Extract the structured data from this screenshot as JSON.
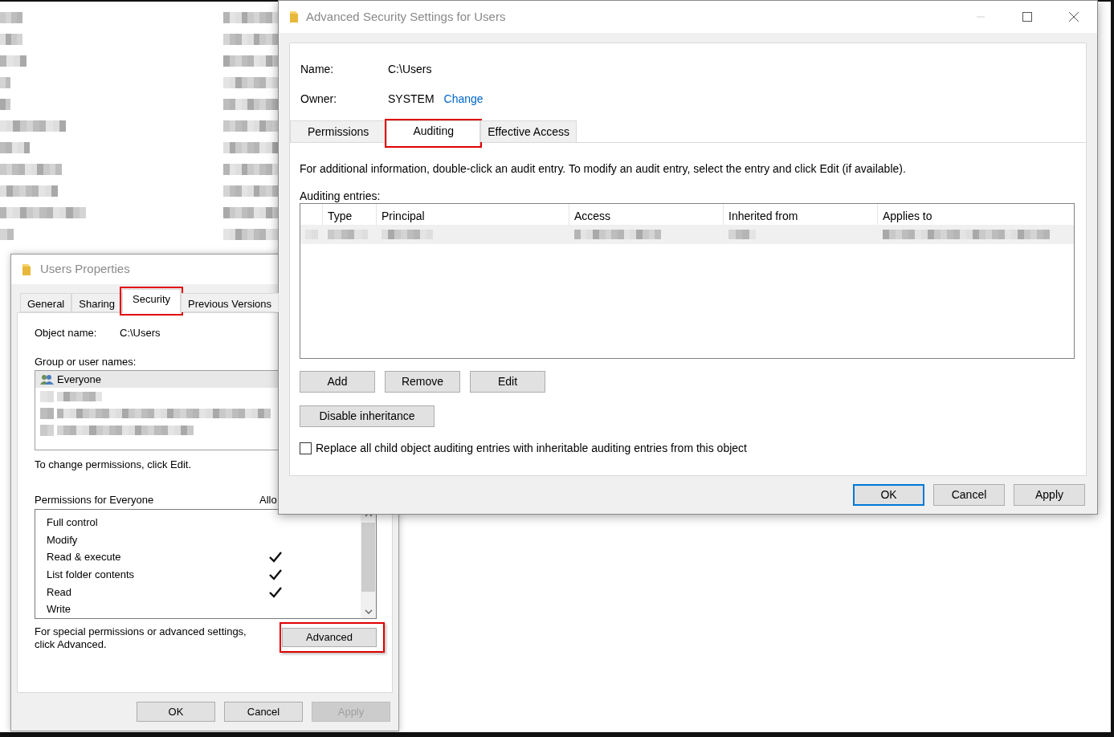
{
  "users_properties": {
    "title": "Users Properties",
    "tabs": [
      {
        "label": "General",
        "selected": false,
        "highlighted": false
      },
      {
        "label": "Sharing",
        "selected": false,
        "highlighted": false
      },
      {
        "label": "Security",
        "selected": true,
        "highlighted": true
      },
      {
        "label": "Previous Versions",
        "selected": false,
        "highlighted": false
      }
    ],
    "object_name_label": "Object name:",
    "object_name": "C:\\Users",
    "group_label": "Group or user names:",
    "users": [
      {
        "kind": "user",
        "name": "Everyone",
        "selected": true
      },
      {
        "kind": "redacted",
        "selected": false
      },
      {
        "kind": "redacted",
        "selected": false
      },
      {
        "kind": "redacted",
        "selected": false
      }
    ],
    "change_hint": "To change permissions, click Edit.",
    "permissions_label": "Permissions for Everyone",
    "allow_header": "Allo",
    "permissions": [
      {
        "name": "Full control",
        "allow": false
      },
      {
        "name": "Modify",
        "allow": false
      },
      {
        "name": "Read & execute",
        "allow": true
      },
      {
        "name": "List folder contents",
        "allow": true
      },
      {
        "name": "Read",
        "allow": true
      },
      {
        "name": "Write",
        "allow": false
      }
    ],
    "advanced_hint": "For special permissions or advanced settings, click Advanced.",
    "advanced_button": {
      "label": "Advanced",
      "highlighted": true
    },
    "buttons": [
      {
        "label": "OK",
        "disabled": false
      },
      {
        "label": "Cancel",
        "disabled": false
      },
      {
        "label": "Apply",
        "disabled": true
      }
    ]
  },
  "advanced_security": {
    "title": "Advanced Security Settings for Users",
    "name_label": "Name:",
    "name": "C:\\Users",
    "owner_label": "Owner:",
    "owner": "SYSTEM",
    "change_link": "Change",
    "tabs": [
      {
        "label": "Permissions",
        "selected": false,
        "highlighted": false
      },
      {
        "label": "Auditing",
        "selected": true,
        "highlighted": true
      },
      {
        "label": "Effective Access",
        "selected": false,
        "highlighted": false
      }
    ],
    "info": "For additional information, double-click an audit entry. To modify an audit entry, select the entry and click Edit (if available).",
    "entries_label": "Auditing entries:",
    "columns": [
      "Type",
      "Principal",
      "Access",
      "Inherited from",
      "Applies to"
    ],
    "entries": [
      {
        "selected": true
      }
    ],
    "entry_buttons": [
      "Add",
      "Remove",
      "Edit"
    ],
    "inheritance_button": "Disable inheritance",
    "replace_checkbox": {
      "label": "Replace all child object auditing entries with inheritable auditing entries from this object",
      "checked": false
    },
    "buttons": [
      {
        "label": "OK",
        "default": true
      },
      {
        "label": "Cancel",
        "default": false
      },
      {
        "label": "Apply",
        "default": false
      }
    ]
  }
}
